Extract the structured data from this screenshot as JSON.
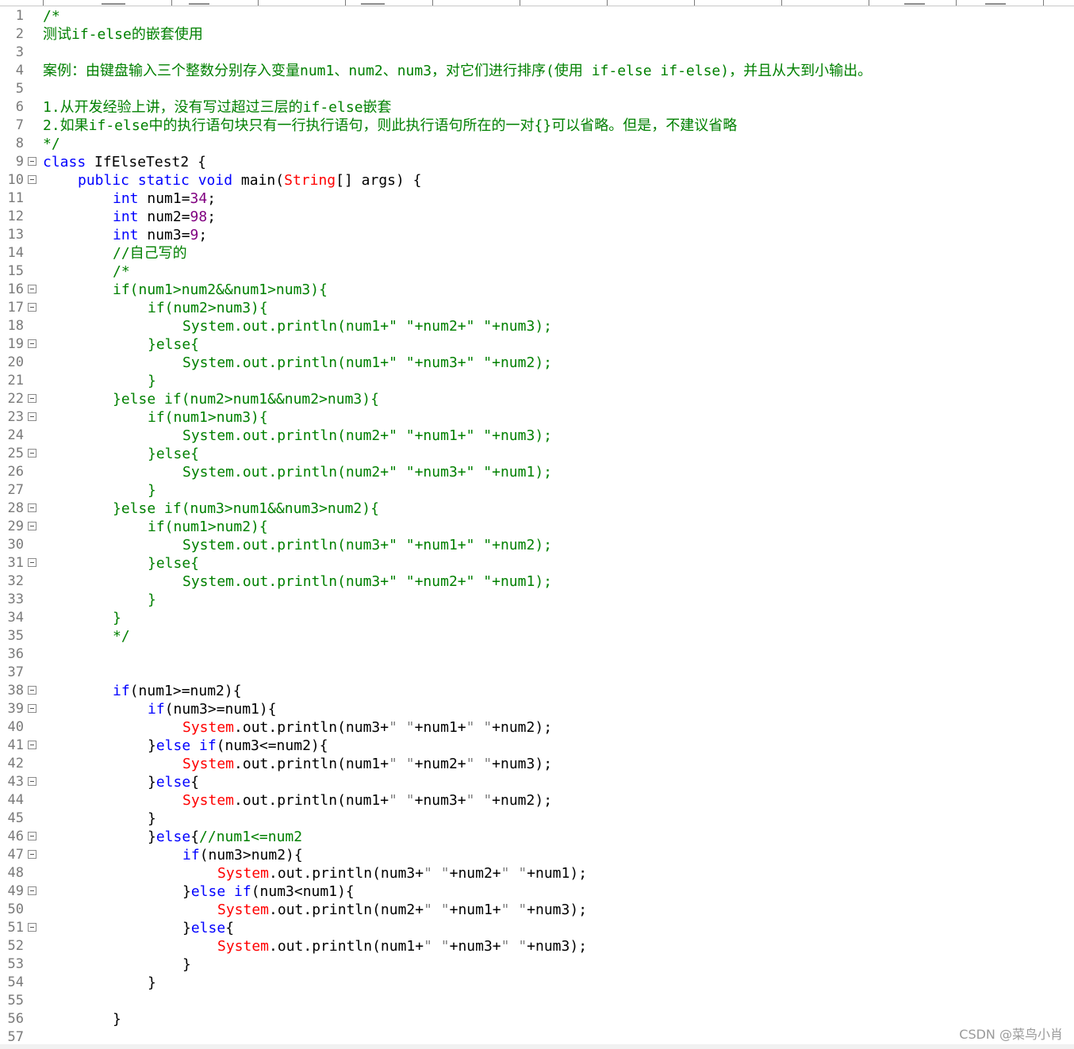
{
  "editor": {
    "colors": {
      "plain": "#000000",
      "keyword": "#0000ff",
      "comment": "#008000",
      "number": "#800080",
      "class": "#ff0000",
      "string": "#808080",
      "line_number": "#7a7a7a"
    },
    "lines": [
      {
        "n": "1",
        "fold": false,
        "indent": 0,
        "tokens": [
          {
            "t": "comment",
            "v": "/*"
          }
        ]
      },
      {
        "n": "2",
        "fold": false,
        "indent": 0,
        "tokens": [
          {
            "t": "comment",
            "v": "测试if-else的嵌套使用"
          }
        ]
      },
      {
        "n": "3",
        "fold": false,
        "indent": 0,
        "tokens": []
      },
      {
        "n": "4",
        "fold": false,
        "indent": 0,
        "tokens": [
          {
            "t": "comment",
            "v": "案例：由键盘输入三个整数分别存入变量num1、num2、num3，对它们进行排序(使用 if-else if-else)，并且从大到小输出。"
          }
        ]
      },
      {
        "n": "5",
        "fold": false,
        "indent": 0,
        "tokens": []
      },
      {
        "n": "6",
        "fold": false,
        "indent": 0,
        "tokens": [
          {
            "t": "comment",
            "v": "1.从开发经验上讲，没有写过超过三层的if-else嵌套"
          }
        ]
      },
      {
        "n": "7",
        "fold": false,
        "indent": 0,
        "tokens": [
          {
            "t": "comment",
            "v": "2.如果if-else中的执行语句块只有一行执行语句，则此执行语句所在的一对{}可以省略。但是，不建议省略"
          }
        ]
      },
      {
        "n": "8",
        "fold": false,
        "indent": 0,
        "tokens": [
          {
            "t": "comment",
            "v": "*/"
          }
        ]
      },
      {
        "n": "9",
        "fold": true,
        "indent": 0,
        "tokens": [
          {
            "t": "keyword",
            "v": "class"
          },
          {
            "t": "plain",
            "v": " IfElseTest2 {"
          }
        ]
      },
      {
        "n": "10",
        "fold": true,
        "indent": 1,
        "tokens": [
          {
            "t": "keyword",
            "v": "public static void"
          },
          {
            "t": "plain",
            "v": " main("
          },
          {
            "t": "class",
            "v": "String"
          },
          {
            "t": "plain",
            "v": "[] args) {"
          }
        ]
      },
      {
        "n": "11",
        "fold": false,
        "indent": 2,
        "tokens": [
          {
            "t": "keyword",
            "v": "int"
          },
          {
            "t": "plain",
            "v": " num1="
          },
          {
            "t": "number",
            "v": "34"
          },
          {
            "t": "plain",
            "v": ";"
          }
        ]
      },
      {
        "n": "12",
        "fold": false,
        "indent": 2,
        "tokens": [
          {
            "t": "keyword",
            "v": "int"
          },
          {
            "t": "plain",
            "v": " num2="
          },
          {
            "t": "number",
            "v": "98"
          },
          {
            "t": "plain",
            "v": ";"
          }
        ]
      },
      {
        "n": "13",
        "fold": false,
        "indent": 2,
        "tokens": [
          {
            "t": "keyword",
            "v": "int"
          },
          {
            "t": "plain",
            "v": " num3="
          },
          {
            "t": "number",
            "v": "9"
          },
          {
            "t": "plain",
            "v": ";"
          }
        ]
      },
      {
        "n": "14",
        "fold": false,
        "indent": 2,
        "tokens": [
          {
            "t": "comment",
            "v": "//自己写的"
          }
        ]
      },
      {
        "n": "15",
        "fold": false,
        "indent": 2,
        "tokens": [
          {
            "t": "comment",
            "v": "/*"
          }
        ]
      },
      {
        "n": "16",
        "fold": true,
        "indent": 2,
        "tokens": [
          {
            "t": "comment",
            "v": "if(num1>num2&&num1>num3){"
          }
        ]
      },
      {
        "n": "17",
        "fold": true,
        "indent": 3,
        "tokens": [
          {
            "t": "comment",
            "v": "if(num2>num3){"
          }
        ]
      },
      {
        "n": "18",
        "fold": false,
        "indent": 4,
        "tokens": [
          {
            "t": "comment",
            "v": "System.out.println(num1+\" \"+num2+\" \"+num3);"
          }
        ]
      },
      {
        "n": "19",
        "fold": true,
        "indent": 3,
        "tokens": [
          {
            "t": "comment",
            "v": "}else{"
          }
        ]
      },
      {
        "n": "20",
        "fold": false,
        "indent": 4,
        "tokens": [
          {
            "t": "comment",
            "v": "System.out.println(num1+\" \"+num3+\" \"+num2);"
          }
        ]
      },
      {
        "n": "21",
        "fold": false,
        "indent": 3,
        "tokens": [
          {
            "t": "comment",
            "v": "}"
          }
        ]
      },
      {
        "n": "22",
        "fold": true,
        "indent": 2,
        "tokens": [
          {
            "t": "comment",
            "v": "}else if(num2>num1&&num2>num3){"
          }
        ]
      },
      {
        "n": "23",
        "fold": true,
        "indent": 3,
        "tokens": [
          {
            "t": "comment",
            "v": "if(num1>num3){"
          }
        ]
      },
      {
        "n": "24",
        "fold": false,
        "indent": 4,
        "tokens": [
          {
            "t": "comment",
            "v": "System.out.println(num2+\" \"+num1+\" \"+num3);"
          }
        ]
      },
      {
        "n": "25",
        "fold": true,
        "indent": 3,
        "tokens": [
          {
            "t": "comment",
            "v": "}else{"
          }
        ]
      },
      {
        "n": "26",
        "fold": false,
        "indent": 4,
        "tokens": [
          {
            "t": "comment",
            "v": "System.out.println(num2+\" \"+num3+\" \"+num1);"
          }
        ]
      },
      {
        "n": "27",
        "fold": false,
        "indent": 3,
        "tokens": [
          {
            "t": "comment",
            "v": "}"
          }
        ]
      },
      {
        "n": "28",
        "fold": true,
        "indent": 2,
        "tokens": [
          {
            "t": "comment",
            "v": "}else if(num3>num1&&num3>num2){"
          }
        ]
      },
      {
        "n": "29",
        "fold": true,
        "indent": 3,
        "tokens": [
          {
            "t": "comment",
            "v": "if(num1>num2){"
          }
        ]
      },
      {
        "n": "30",
        "fold": false,
        "indent": 4,
        "tokens": [
          {
            "t": "comment",
            "v": "System.out.println(num3+\" \"+num1+\" \"+num2);"
          }
        ]
      },
      {
        "n": "31",
        "fold": true,
        "indent": 3,
        "tokens": [
          {
            "t": "comment",
            "v": "}else{"
          }
        ]
      },
      {
        "n": "32",
        "fold": false,
        "indent": 4,
        "tokens": [
          {
            "t": "comment",
            "v": "System.out.println(num3+\" \"+num2+\" \"+num1);"
          }
        ]
      },
      {
        "n": "33",
        "fold": false,
        "indent": 3,
        "tokens": [
          {
            "t": "comment",
            "v": "}"
          }
        ]
      },
      {
        "n": "34",
        "fold": false,
        "indent": 2,
        "tokens": [
          {
            "t": "comment",
            "v": "}"
          }
        ]
      },
      {
        "n": "35",
        "fold": false,
        "indent": 2,
        "tokens": [
          {
            "t": "comment",
            "v": "*/"
          }
        ]
      },
      {
        "n": "36",
        "fold": false,
        "indent": 0,
        "tokens": []
      },
      {
        "n": "37",
        "fold": false,
        "indent": 0,
        "tokens": []
      },
      {
        "n": "38",
        "fold": true,
        "indent": 2,
        "tokens": [
          {
            "t": "keyword",
            "v": "if"
          },
          {
            "t": "plain",
            "v": "(num1>=num2){"
          }
        ]
      },
      {
        "n": "39",
        "fold": true,
        "indent": 3,
        "tokens": [
          {
            "t": "keyword",
            "v": "if"
          },
          {
            "t": "plain",
            "v": "(num3>=num1){"
          }
        ]
      },
      {
        "n": "40",
        "fold": false,
        "indent": 4,
        "tokens": [
          {
            "t": "class",
            "v": "System"
          },
          {
            "t": "plain",
            "v": ".out.println(num3+"
          },
          {
            "t": "string",
            "v": "\" \""
          },
          {
            "t": "plain",
            "v": "+num1+"
          },
          {
            "t": "string",
            "v": "\" \""
          },
          {
            "t": "plain",
            "v": "+num2);"
          }
        ]
      },
      {
        "n": "41",
        "fold": true,
        "indent": 3,
        "tokens": [
          {
            "t": "plain",
            "v": "}"
          },
          {
            "t": "keyword",
            "v": "else if"
          },
          {
            "t": "plain",
            "v": "(num3<=num2){"
          }
        ]
      },
      {
        "n": "42",
        "fold": false,
        "indent": 4,
        "tokens": [
          {
            "t": "class",
            "v": "System"
          },
          {
            "t": "plain",
            "v": ".out.println(num1+"
          },
          {
            "t": "string",
            "v": "\" \""
          },
          {
            "t": "plain",
            "v": "+num2+"
          },
          {
            "t": "string",
            "v": "\" \""
          },
          {
            "t": "plain",
            "v": "+num3);"
          }
        ]
      },
      {
        "n": "43",
        "fold": true,
        "indent": 3,
        "tokens": [
          {
            "t": "plain",
            "v": "}"
          },
          {
            "t": "keyword",
            "v": "else"
          },
          {
            "t": "plain",
            "v": "{"
          }
        ]
      },
      {
        "n": "44",
        "fold": false,
        "indent": 4,
        "tokens": [
          {
            "t": "class",
            "v": "System"
          },
          {
            "t": "plain",
            "v": ".out.println(num1+"
          },
          {
            "t": "string",
            "v": "\" \""
          },
          {
            "t": "plain",
            "v": "+num3+"
          },
          {
            "t": "string",
            "v": "\" \""
          },
          {
            "t": "plain",
            "v": "+num2);"
          }
        ]
      },
      {
        "n": "45",
        "fold": false,
        "indent": 3,
        "tokens": [
          {
            "t": "plain",
            "v": "}"
          }
        ]
      },
      {
        "n": "46",
        "fold": true,
        "indent": 3,
        "tokens": [
          {
            "t": "plain",
            "v": "}"
          },
          {
            "t": "keyword",
            "v": "else"
          },
          {
            "t": "plain",
            "v": "{"
          },
          {
            "t": "comment",
            "v": "//num1<=num2"
          }
        ]
      },
      {
        "n": "47",
        "fold": true,
        "indent": 4,
        "tokens": [
          {
            "t": "keyword",
            "v": "if"
          },
          {
            "t": "plain",
            "v": "(num3>num2){"
          }
        ]
      },
      {
        "n": "48",
        "fold": false,
        "indent": 5,
        "tokens": [
          {
            "t": "class",
            "v": "System"
          },
          {
            "t": "plain",
            "v": ".out.println(num3+"
          },
          {
            "t": "string",
            "v": "\" \""
          },
          {
            "t": "plain",
            "v": "+num2+"
          },
          {
            "t": "string",
            "v": "\" \""
          },
          {
            "t": "plain",
            "v": "+num1);"
          }
        ]
      },
      {
        "n": "49",
        "fold": true,
        "indent": 4,
        "tokens": [
          {
            "t": "plain",
            "v": "}"
          },
          {
            "t": "keyword",
            "v": "else if"
          },
          {
            "t": "plain",
            "v": "(num3<num1){"
          }
        ]
      },
      {
        "n": "50",
        "fold": false,
        "indent": 5,
        "tokens": [
          {
            "t": "class",
            "v": "System"
          },
          {
            "t": "plain",
            "v": ".out.println(num2+"
          },
          {
            "t": "string",
            "v": "\" \""
          },
          {
            "t": "plain",
            "v": "+num1+"
          },
          {
            "t": "string",
            "v": "\" \""
          },
          {
            "t": "plain",
            "v": "+num3);"
          }
        ]
      },
      {
        "n": "51",
        "fold": true,
        "indent": 4,
        "tokens": [
          {
            "t": "plain",
            "v": "}"
          },
          {
            "t": "keyword",
            "v": "else"
          },
          {
            "t": "plain",
            "v": "{"
          }
        ]
      },
      {
        "n": "52",
        "fold": false,
        "indent": 5,
        "tokens": [
          {
            "t": "class",
            "v": "System"
          },
          {
            "t": "plain",
            "v": ".out.println(num1+"
          },
          {
            "t": "string",
            "v": "\" \""
          },
          {
            "t": "plain",
            "v": "+num3+"
          },
          {
            "t": "string",
            "v": "\" \""
          },
          {
            "t": "plain",
            "v": "+num3);"
          }
        ]
      },
      {
        "n": "53",
        "fold": false,
        "indent": 4,
        "tokens": [
          {
            "t": "plain",
            "v": "}"
          }
        ]
      },
      {
        "n": "54",
        "fold": false,
        "indent": 3,
        "tokens": [
          {
            "t": "plain",
            "v": "}"
          }
        ]
      },
      {
        "n": "55",
        "fold": false,
        "indent": 0,
        "tokens": []
      },
      {
        "n": "56",
        "fold": false,
        "indent": 2,
        "tokens": [
          {
            "t": "plain",
            "v": "}"
          }
        ]
      },
      {
        "n": "57",
        "fold": false,
        "indent": 0,
        "tokens": []
      }
    ]
  },
  "watermark": {
    "text": "CSDN @菜鸟小肖"
  }
}
